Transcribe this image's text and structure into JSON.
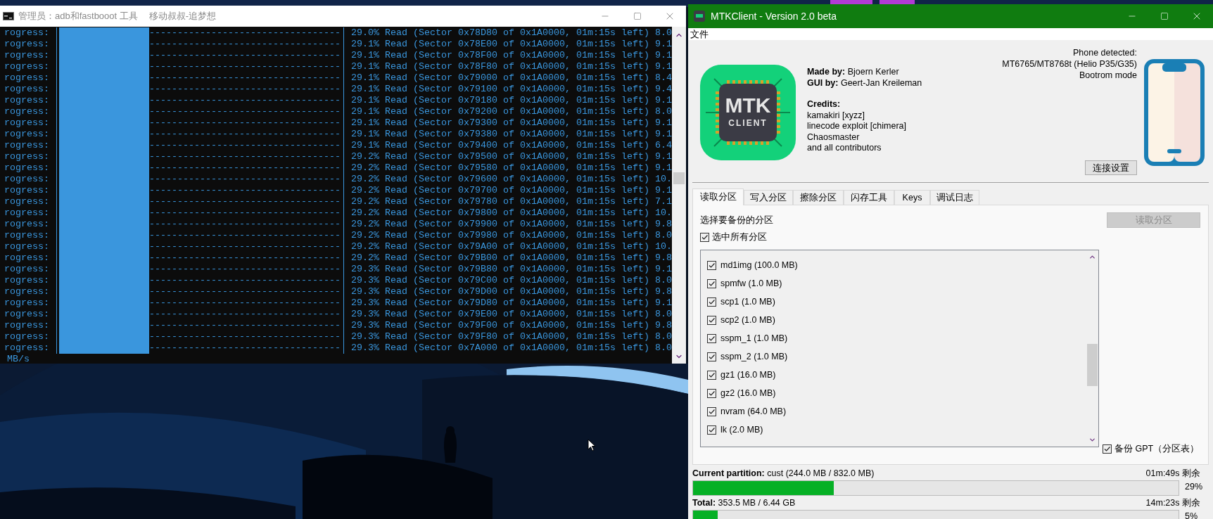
{
  "console": {
    "title": "管理员：adb和fastbooot 工具",
    "subtitle": "移动叔叔-追梦想",
    "rows": [
      {
        "label": "rogress:",
        "level": 0.32,
        "dashes": "----------------------------------",
        "text": "29.0% Read (Sector 0x78D80 of 0x1A0000, 01m:15s left) 8.0"
      },
      {
        "label": "rogress:",
        "level": 0.32,
        "dashes": "----------------------------------",
        "text": "29.1% Read (Sector 0x78E00 of 0x1A0000, 01m:15s left) 9.1"
      },
      {
        "label": "rogress:",
        "level": 0.32,
        "dashes": "----------------------------------",
        "text": "29.1% Read (Sector 0x78F00 of 0x1A0000, 01m:15s left) 9.1"
      },
      {
        "label": "rogress:",
        "level": 0.32,
        "dashes": "----------------------------------",
        "text": "29.1% Read (Sector 0x78F80 of 0x1A0000, 01m:15s left) 9.1"
      },
      {
        "label": "rogress:",
        "level": 0.32,
        "dashes": "----------------------------------",
        "text": "29.1% Read (Sector 0x79000 of 0x1A0000, 01m:15s left) 8.4"
      },
      {
        "label": "rogress:",
        "level": 0.32,
        "dashes": "----------------------------------",
        "text": "29.1% Read (Sector 0x79100 of 0x1A0000, 01m:15s left) 9.4"
      },
      {
        "label": "rogress:",
        "level": 0.32,
        "dashes": "----------------------------------",
        "text": "29.1% Read (Sector 0x79180 of 0x1A0000, 01m:15s left) 9.1"
      },
      {
        "label": "rogress:",
        "level": 0.32,
        "dashes": "----------------------------------",
        "text": "29.1% Read (Sector 0x79200 of 0x1A0000, 01m:15s left) 8.0"
      },
      {
        "label": "rogress:",
        "level": 0.32,
        "dashes": "----------------------------------",
        "text": "29.1% Read (Sector 0x79300 of 0x1A0000, 01m:15s left) 9.1"
      },
      {
        "label": "rogress:",
        "level": 0.32,
        "dashes": "----------------------------------",
        "text": "29.1% Read (Sector 0x79380 of 0x1A0000, 01m:15s left) 9.1"
      },
      {
        "label": "rogress:",
        "level": 0.32,
        "dashes": "----------------------------------",
        "text": "29.1% Read (Sector 0x79400 of 0x1A0000, 01m:15s left) 6.4"
      },
      {
        "label": "rogress:",
        "level": 0.32,
        "dashes": "----------------------------------",
        "text": "29.2% Read (Sector 0x79500 of 0x1A0000, 01m:15s left) 9.1"
      },
      {
        "label": "rogress:",
        "level": 0.32,
        "dashes": "----------------------------------",
        "text": "29.2% Read (Sector 0x79580 of 0x1A0000, 01m:15s left) 9.1"
      },
      {
        "label": "rogress:",
        "level": 0.32,
        "dashes": "----------------------------------",
        "text": "29.2% Read (Sector 0x79600 of 0x1A0000, 01m:15s left) 10."
      },
      {
        "label": "rogress:",
        "level": 0.32,
        "dashes": "----------------------------------",
        "text": "29.2% Read (Sector 0x79700 of 0x1A0000, 01m:15s left) 9.1"
      },
      {
        "label": "rogress:",
        "level": 0.32,
        "dashes": "----------------------------------",
        "text": "29.2% Read (Sector 0x79780 of 0x1A0000, 01m:15s left) 7.1"
      },
      {
        "label": "rogress:",
        "level": 0.32,
        "dashes": "----------------------------------",
        "text": "29.2% Read (Sector 0x79800 of 0x1A0000, 01m:15s left) 10."
      },
      {
        "label": "rogress:",
        "level": 0.32,
        "dashes": "----------------------------------",
        "text": "29.2% Read (Sector 0x79900 of 0x1A0000, 01m:15s left) 9.8"
      },
      {
        "label": "rogress:",
        "level": 0.32,
        "dashes": "----------------------------------",
        "text": "29.2% Read (Sector 0x79980 of 0x1A0000, 01m:15s left) 8.0"
      },
      {
        "label": "rogress:",
        "level": 0.32,
        "dashes": "----------------------------------",
        "text": "29.2% Read (Sector 0x79A00 of 0x1A0000, 01m:15s left) 10."
      },
      {
        "label": "rogress:",
        "level": 0.32,
        "dashes": "----------------------------------",
        "text": "29.2% Read (Sector 0x79B00 of 0x1A0000, 01m:15s left) 9.8"
      },
      {
        "label": "rogress:",
        "level": 0.32,
        "dashes": "----------------------------------",
        "text": "29.3% Read (Sector 0x79B80 of 0x1A0000, 01m:15s left) 9.1"
      },
      {
        "label": "rogress:",
        "level": 0.32,
        "dashes": "----------------------------------",
        "text": "29.3% Read (Sector 0x79C00 of 0x1A0000, 01m:15s left) 8.0"
      },
      {
        "label": "rogress:",
        "level": 0.32,
        "dashes": "----------------------------------",
        "text": "29.3% Read (Sector 0x79D00 of 0x1A0000, 01m:15s left) 9.8"
      },
      {
        "label": "rogress:",
        "level": 0.32,
        "dashes": "----------------------------------",
        "text": "29.3% Read (Sector 0x79D80 of 0x1A0000, 01m:15s left) 9.1"
      },
      {
        "label": "rogress:",
        "level": 0.32,
        "dashes": "----------------------------------",
        "text": "29.3% Read (Sector 0x79E00 of 0x1A0000, 01m:15s left) 8.0"
      },
      {
        "label": "rogress:",
        "level": 0.32,
        "dashes": "----------------------------------",
        "text": "29.3% Read (Sector 0x79F00 of 0x1A0000, 01m:15s left) 9.8"
      },
      {
        "label": "rogress:",
        "level": 0.32,
        "dashes": "----------------------------------",
        "text": "29.3% Read (Sector 0x79F80 of 0x1A0000, 01m:15s left) 8.0"
      },
      {
        "label": "rogress:",
        "level": 0.32,
        "dashes": "----------------------------------",
        "text": "29.3% Read (Sector 0x7A000 of 0x1A0000, 01m:15s left) 8.0"
      }
    ],
    "tail": "MB/s"
  },
  "mtk": {
    "title": "MTKClient - Version 2.0 beta",
    "menu": [
      "文件"
    ],
    "logo": {
      "line1": "MTK",
      "line2": "CLIENT"
    },
    "about": [
      "**Made by:** Bjoern Kerler",
      "**GUI by:** Geert-Jan Kreileman"
    ],
    "credits_heading": "Credits:",
    "credits": [
      "kamakiri [xyzz]",
      "linecode exploit [chimera]",
      "Chaosmaster",
      "and all contributors"
    ],
    "phone_status": [
      "Phone detected:",
      "MT6765/MT8768t (Helio P35/G35)",
      "Bootrom mode"
    ],
    "connect_button": "连接设置",
    "tabs": [
      {
        "label": "读取分区",
        "selected": true
      },
      {
        "label": "写入分区",
        "selected": false
      },
      {
        "label": "擦除分区",
        "selected": false
      },
      {
        "label": "闪存工具",
        "selected": false
      },
      {
        "label": "Keys",
        "selected": false
      },
      {
        "label": "调试日志",
        "selected": false
      }
    ],
    "panel": {
      "heading": "选择要备份的分区",
      "read_button": {
        "label": "读取分区",
        "disabled": true
      },
      "select_all": {
        "label": "选中所有分区",
        "checked": true
      },
      "partitions": [
        {
          "label": "md1img (100.0 MB)",
          "checked": true
        },
        {
          "label": "spmfw (1.0 MB)",
          "checked": true
        },
        {
          "label": "scp1 (1.0 MB)",
          "checked": true
        },
        {
          "label": "scp2 (1.0 MB)",
          "checked": true
        },
        {
          "label": "sspm_1 (1.0 MB)",
          "checked": true
        },
        {
          "label": "sspm_2 (1.0 MB)",
          "checked": true
        },
        {
          "label": "gz1 (16.0 MB)",
          "checked": true
        },
        {
          "label": "gz2 (16.0 MB)",
          "checked": true
        },
        {
          "label": "nvram (64.0 MB)",
          "checked": true
        },
        {
          "label": "lk (2.0 MB)",
          "checked": true
        }
      ],
      "backup_gpt": {
        "label": "备份 GPT（分区表）",
        "checked": true
      }
    },
    "progress": [
      {
        "label": "**Current partition:** cust (244.0 MB / 832.0 MB)",
        "remaining": "01m:49s 剩余",
        "level": 0.29,
        "percent": "29%"
      },
      {
        "label": "**Total:** 353.5 MB / 6.44 GB",
        "remaining": "14m:23s 剩余",
        "level": 0.05,
        "percent": "5%"
      }
    ]
  }
}
